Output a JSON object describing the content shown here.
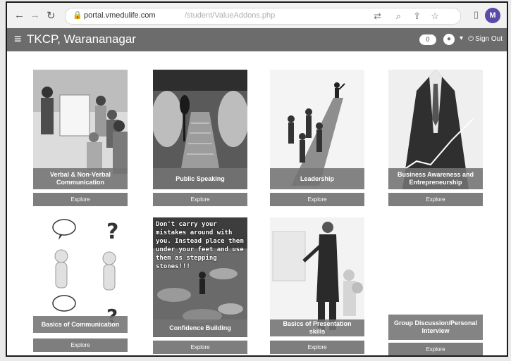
{
  "browser": {
    "url_host": "portal.vmedulife.com",
    "url_path": "/student/ValueAddons.php",
    "profile_initial": "M"
  },
  "header": {
    "title": "TKCP, Warananagar",
    "notification_count": "0",
    "signout_label": "Sign Out"
  },
  "colors": {
    "header": "#6c6c6c",
    "button": "#7e7e7e"
  },
  "cards": [
    {
      "title": "Verbal & Non-Verbal Communication",
      "button": "Explore"
    },
    {
      "title": "Public Speaking",
      "button": "Explore"
    },
    {
      "title": "Leadership",
      "button": "Explore"
    },
    {
      "title": "Business Awareness and Entrepreneurship",
      "button": "Explore"
    },
    {
      "title": "Basics of Communication",
      "button": "Explore"
    },
    {
      "title": "Confidence Building",
      "button": "Explore",
      "image_text": "Don't carry your mistakes around with you. Instead place them under your feet and use them as stepping stones!!!"
    },
    {
      "title": "Basics of Presentation skills",
      "button": "Explore"
    },
    {
      "title": "Group Discussion/Personal Interview",
      "button": "Explore"
    }
  ]
}
